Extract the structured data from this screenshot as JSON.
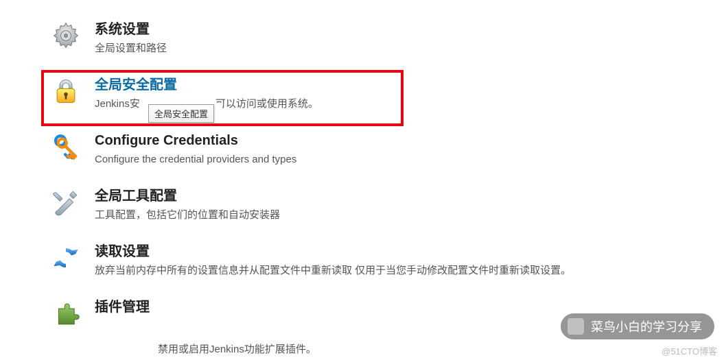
{
  "items": [
    {
      "title": "系统设置",
      "desc": "全局设置和路径",
      "link": false
    },
    {
      "title": "全局安全配置",
      "desc_pre": "Jenkins安",
      "desc_post": "可以访问或使用系统。",
      "link": true
    },
    {
      "title": "Configure Credentials",
      "desc": "Configure the credential providers and types",
      "link": false
    },
    {
      "title": "全局工具配置",
      "desc": "工具配置，包括它们的位置和自动安装器",
      "link": false
    },
    {
      "title": "读取设置",
      "desc": "放弃当前内存中所有的设置信息并从配置文件中重新读取 仅用于当您手动修改配置文件时重新读取设置。",
      "link": false
    },
    {
      "title": "插件管理",
      "desc": "",
      "link": false
    }
  ],
  "tooltip": "全局安全配置",
  "plugin_subtext": "禁用或启用Jenkins功能扩展插件。",
  "watermark_text": "菜鸟小白的学习分享",
  "watermark_corner": "@51CTO博客"
}
